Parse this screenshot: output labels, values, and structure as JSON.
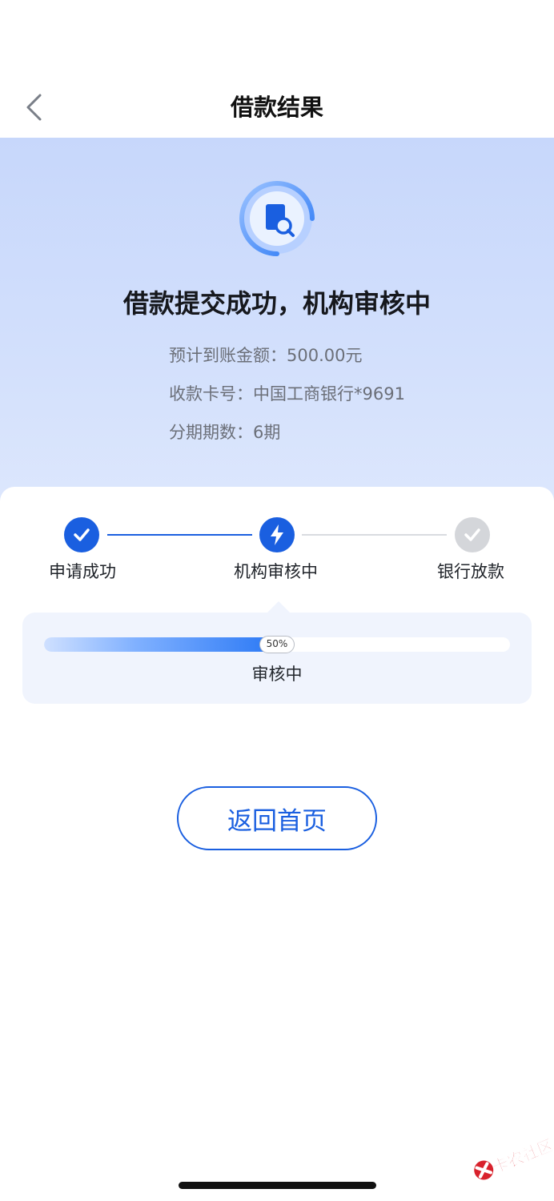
{
  "nav": {
    "title": "借款结果",
    "back_icon": "chevron-left-icon"
  },
  "hero": {
    "icon": "document-search-icon",
    "headline": "借款提交成功，机构审核中",
    "details": [
      {
        "label": "预计到账金额：",
        "value": "500.00元"
      },
      {
        "label": "收款卡号：",
        "value": "中国工商银行*9691"
      },
      {
        "label": "分期期数：",
        "value": "6期"
      }
    ]
  },
  "steps": [
    {
      "label": "申请成功",
      "state": "done",
      "icon": "check-icon"
    },
    {
      "label": "机构审核中",
      "state": "active",
      "icon": "lightning-icon"
    },
    {
      "label": "银行放款",
      "state": "pending",
      "icon": "check-icon"
    }
  ],
  "progress": {
    "percent": 50,
    "badge": "50%",
    "status": "审核中"
  },
  "actions": {
    "home_button": "返回首页"
  },
  "watermark": {
    "text": "卡农社区"
  },
  "colors": {
    "primary": "#1a5fe0",
    "hero_bg": "#c7d7fb",
    "pending": "#d4d6da",
    "panel_bg": "#f0f4fd"
  }
}
